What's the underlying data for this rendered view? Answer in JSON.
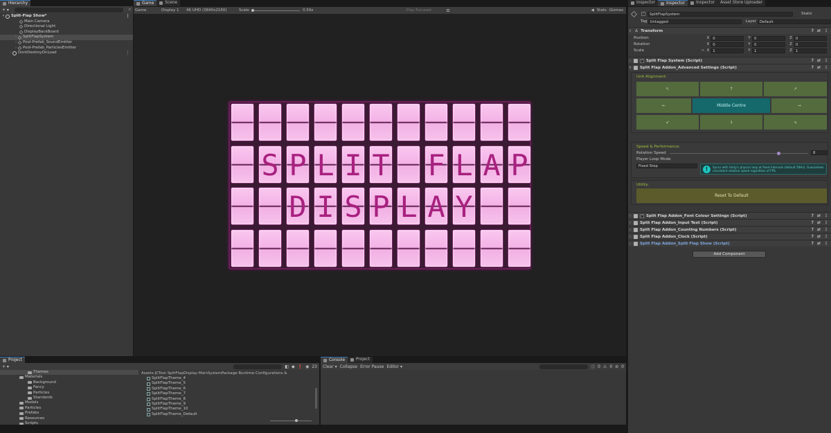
{
  "hierarchy": {
    "tab": "Hierarchy",
    "scene": "Split-Flap Show*",
    "items": [
      {
        "label": "Main Camera"
      },
      {
        "label": "Directional Light"
      },
      {
        "label": "DisplayBackBoard"
      },
      {
        "label": "SplitFlapSystem"
      },
      {
        "label": "Pool-Prefab_SoundEmitter"
      },
      {
        "label": "Pool-Prefab_ParticlesEmitter"
      }
    ],
    "dont_destroy": "DontDestroyOnLoad",
    "add_label": "+ ▾"
  },
  "game": {
    "tabs": [
      "Game",
      "Scene"
    ],
    "mode": "Game",
    "display": "Display 1",
    "resolution": "4K UHD (3840x2160)",
    "scale_label": "Scale",
    "scale_value": "0.59x",
    "play_focused": "Play Focused",
    "stats": "Stats",
    "gizmos": "Gizmos",
    "rows": [
      "           ",
      " SPLIT FLAP",
      "  DISPLAY  ",
      "           "
    ]
  },
  "inspector": {
    "tabs": [
      "Inspector",
      "Inspector",
      "Inspector",
      "Asset Store Uploader"
    ],
    "object_name": "SplitFlapSystem",
    "static_label": "Static",
    "tag_label": "Tag",
    "tag_value": "Untagged",
    "layer_label": "Layer",
    "layer_value": "Default",
    "transform": {
      "title": "Transform",
      "rows": [
        {
          "label": "Position",
          "x": "0",
          "y": "0",
          "z": "0"
        },
        {
          "label": "Rotation",
          "x": "0",
          "y": "0",
          "z": "0"
        },
        {
          "label": "Scale",
          "x": "1",
          "y": "1",
          "z": "1"
        }
      ],
      "x": "X",
      "y": "Y",
      "z": "Z"
    },
    "components": [
      "Split Flap System (Script)",
      "Split Flap Addon_Advanced Settings (Script)"
    ],
    "unit_alignment_label": "Unit Alignment:",
    "alignment_buttons": [
      "↖",
      "↑",
      "↗",
      "←",
      "Middle Centre",
      "→",
      "↙",
      "↓",
      "↘"
    ],
    "speed_section": "Speed & Performance:",
    "rotation_speed_label": "Rotation Speed",
    "rotation_speed_value": "8",
    "player_loop_label": "Player Loop Mode",
    "player_loop_value": "Fixed Step",
    "info_text": "Syncs with Unity's physics loop at fixed intervals (default 50Hz). Guarantees consistent rotation speed regardless of FPS.",
    "utility_label": "Utility:",
    "reset_label": "Reset To Default",
    "more_components": [
      "Split Flap Addon_Font Colour Settings (Script)",
      "Split Flap Addon_Input Text (Script)",
      "Split Flap Addon_Counting Numbers (Script)",
      "Split Flap Addon_Clock (Script)",
      "Split Flap Addon_Split Flap Show (Script)"
    ],
    "add_component": "Add Component",
    "colors": {
      "green": "#546b3e",
      "teal": "#15696b",
      "olive": "#5b5b2b"
    }
  },
  "project": {
    "tab": "Project",
    "tree": [
      {
        "label": "Themes",
        "depth": 3
      },
      {
        "label": "Materials",
        "depth": 2
      },
      {
        "label": "Background",
        "depth": 3
      },
      {
        "label": "Fancy",
        "depth": 3
      },
      {
        "label": "Particles",
        "depth": 3
      },
      {
        "label": "Standards",
        "depth": 3
      },
      {
        "label": "Models",
        "depth": 2
      },
      {
        "label": "Particles",
        "depth": 2
      },
      {
        "label": "Prefabs",
        "depth": 2
      },
      {
        "label": "Resources",
        "depth": 2
      },
      {
        "label": "Scripts",
        "depth": 2
      }
    ],
    "breadcrumb": [
      "Assets",
      "JCTool",
      "SplitFlapDisplay",
      "MainSystemPackage",
      "Runtime",
      "Configurations &"
    ],
    "files": [
      "SplitFlapTheme_4",
      "SplitFlapTheme_5",
      "SplitFlapTheme_6",
      "SplitFlapTheme_7",
      "SplitFlapTheme_8",
      "SplitFlapTheme_9",
      "SplitFlapTheme_10",
      "SplitFlapTheme_Default"
    ],
    "count": "23"
  },
  "console": {
    "tabs": [
      "Console",
      "Project"
    ],
    "buttons": [
      "Clear ▾",
      "Collapse",
      "Error Pause",
      "Editor ▾"
    ],
    "counts": [
      "0",
      "0",
      "0"
    ]
  }
}
